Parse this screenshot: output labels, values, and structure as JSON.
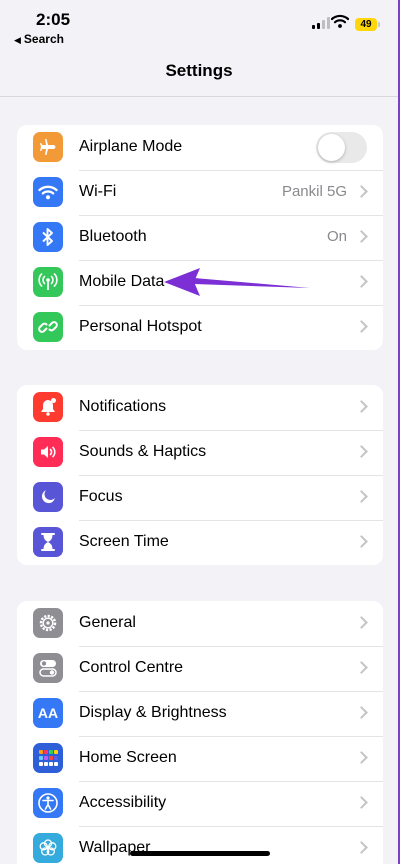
{
  "status_bar": {
    "time": "2:05",
    "back_label": "Search",
    "battery_level": "49"
  },
  "nav": {
    "title": "Settings"
  },
  "colors": {
    "airplane": "#f19a37",
    "wifi": "#3478f6",
    "bluetooth": "#3478f6",
    "mobile_data": "#34c759",
    "hotspot": "#34c759",
    "notifications": "#ff3b30",
    "sounds": "#ff2d55",
    "focus": "#5856d6",
    "screen_time": "#5856d6",
    "general": "#8e8e93",
    "control_centre": "#8e8e93",
    "display": "#3478f6",
    "home_screen": "#3478f6",
    "accessibility": "#3478f6",
    "wallpaper": "#35aadc",
    "annotation_arrow": "#7b2fd4"
  },
  "groups": [
    {
      "rows": [
        {
          "label": "Airplane Mode",
          "icon": "airplane-icon",
          "control": "toggle",
          "toggle_on": false
        },
        {
          "label": "Wi-Fi",
          "icon": "wifi-icon",
          "value": "Pankil 5G"
        },
        {
          "label": "Bluetooth",
          "icon": "bluetooth-icon",
          "value": "On"
        },
        {
          "label": "Mobile Data",
          "icon": "antenna-icon"
        },
        {
          "label": "Personal Hotspot",
          "icon": "link-icon"
        }
      ]
    },
    {
      "rows": [
        {
          "label": "Notifications",
          "icon": "bell-icon"
        },
        {
          "label": "Sounds & Haptics",
          "icon": "speaker-icon"
        },
        {
          "label": "Focus",
          "icon": "moon-icon"
        },
        {
          "label": "Screen Time",
          "icon": "hourglass-icon"
        }
      ]
    },
    {
      "rows": [
        {
          "label": "General",
          "icon": "gear-icon"
        },
        {
          "label": "Control Centre",
          "icon": "switches-icon"
        },
        {
          "label": "Display & Brightness",
          "icon": "text-size-icon",
          "icon_text": "AA"
        },
        {
          "label": "Home Screen",
          "icon": "app-grid-icon"
        },
        {
          "label": "Accessibility",
          "icon": "accessibility-icon"
        },
        {
          "label": "Wallpaper",
          "icon": "flower-icon"
        }
      ]
    }
  ]
}
